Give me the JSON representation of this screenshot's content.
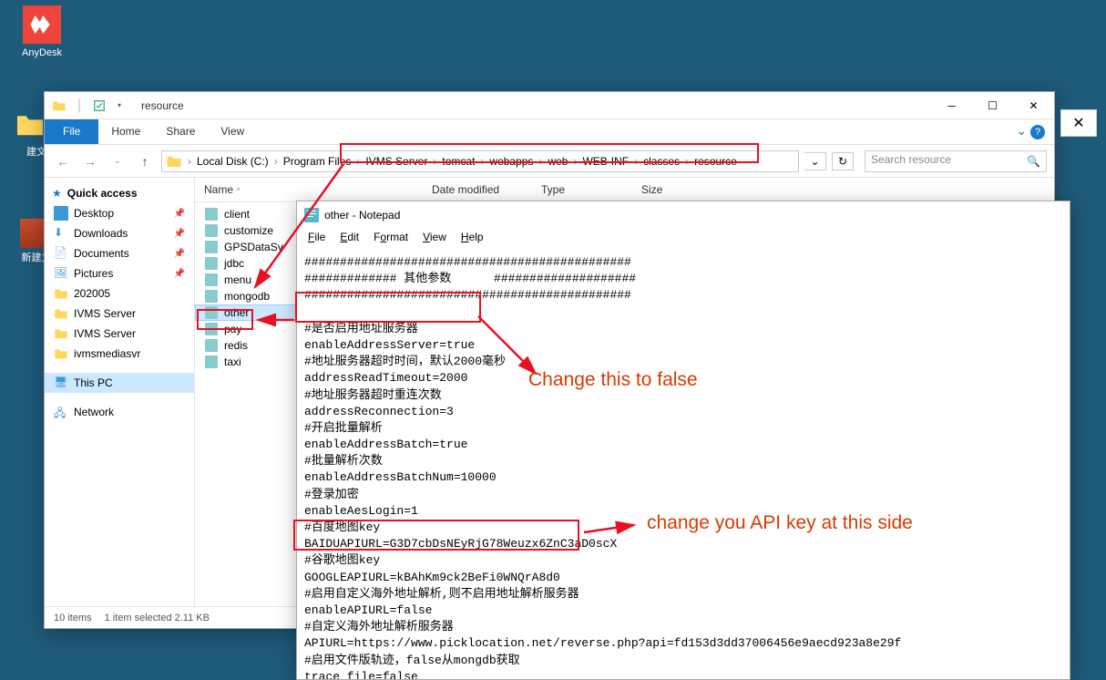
{
  "desktop": {
    "anydesk": "AnyDesk",
    "folder1": "新建文",
    "folder2": "新建文"
  },
  "explorer": {
    "title": "resource",
    "ribbon": {
      "file": "File",
      "home": "Home",
      "share": "Share",
      "view": "View"
    },
    "breadcrumb": [
      "Local Disk (C:)",
      "Program Files",
      "IVMS Server",
      "tomcat",
      "webapps",
      "web",
      "WEB-INF",
      "classes",
      "resource"
    ],
    "search_placeholder": "Search resource",
    "columns": {
      "name": "Name",
      "date": "Date modified",
      "type": "Type",
      "size": "Size"
    },
    "sidebar": {
      "quick_access": "Quick access",
      "items": [
        {
          "label": "Desktop",
          "pinned": true,
          "icon": "desktop"
        },
        {
          "label": "Downloads",
          "pinned": true,
          "icon": "downloads"
        },
        {
          "label": "Documents",
          "pinned": true,
          "icon": "documents"
        },
        {
          "label": "Pictures",
          "pinned": true,
          "icon": "pictures"
        },
        {
          "label": "202005",
          "pinned": false,
          "icon": "folder"
        },
        {
          "label": "IVMS Server",
          "pinned": false,
          "icon": "folder"
        },
        {
          "label": "IVMS Server",
          "pinned": false,
          "icon": "folder"
        },
        {
          "label": "ivmsmediasvr",
          "pinned": false,
          "icon": "folder"
        }
      ],
      "this_pc": "This PC",
      "network": "Network"
    },
    "files": [
      "client",
      "customize",
      "GPSDataSv",
      "jdbc",
      "menu",
      "mongodb",
      "other",
      "pay",
      "redis",
      "taxi"
    ],
    "status": {
      "count": "10 items",
      "selected": "1 item selected  2.11 KB"
    }
  },
  "notepad": {
    "title": "other - Notepad",
    "menus": {
      "file": "File",
      "edit": "Edit",
      "format": "Format",
      "view": "View",
      "help": "Help"
    },
    "content": "##############################################\n############# 其他参数      ####################\n##############################################\n\n#是否启用地址服务器\nenableAddressServer=true\n#地址服务器超时时间，默认2000毫秒\naddressReadTimeout=2000\n#地址服务器超时重连次数\naddressReconnection=3\n#开启批量解析\nenableAddressBatch=true\n#批量解析次数\nenableAddressBatchNum=10000\n#登录加密\nenableAesLogin=1\n#百度地图key\nBAIDUAPIURL=G3D7cbDsNEyRjG78Weuzx6ZnC3aD0scX\n#谷歌地图key\nGOOGLEAPIURL=kBAhKm9ck2BeFi0WNQrA8d0\n#启用自定义海外地址解析,则不启用地址解析服务器\nenableAPIURL=false\n#自定义海外地址解析服务器\nAPIURL=https://www.picklocation.net/reverse.php?api=fd153d3dd37006456e9aecd923a8e29f\n#启用文件版轨迹，false从mongdb获取\ntrace_file=false"
  },
  "annotations": {
    "line1": "Change this to false",
    "line2": "change you API key at this side"
  }
}
